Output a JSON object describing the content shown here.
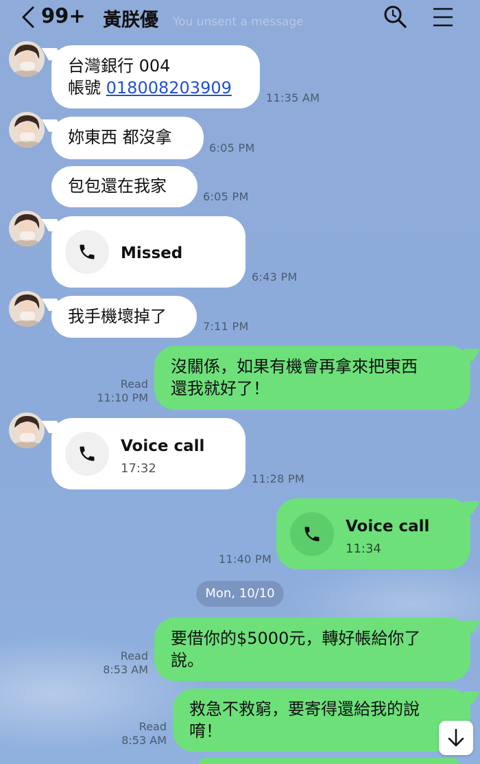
{
  "header": {
    "unread_count": "99+",
    "contact_name": "黃朕優",
    "ghost_notice": "You unsent a message"
  },
  "messages": [
    {
      "line1": "台灣銀行 004",
      "line2_label": "帳號 ",
      "account_number": "018008203909",
      "time": "11:35 AM"
    },
    {
      "text": "妳東西 都沒拿",
      "time": "6:05 PM"
    },
    {
      "text": "包包還在我家",
      "time": "6:05 PM"
    },
    {
      "call_title": "Missed",
      "time": "6:43 PM"
    },
    {
      "text": "我手機壞掉了",
      "time": "7:11 PM"
    },
    {
      "line1": "沒關係，如果有機會再拿來把東西",
      "line2": "還我就好了！",
      "read": "Read",
      "time": "11:10 PM"
    },
    {
      "call_title": "Voice call",
      "call_duration": "17:32",
      "time": "11:28 PM"
    },
    {
      "call_title": "Voice call",
      "call_duration": "11:34",
      "time": "11:40 PM"
    },
    {
      "line1": "要借你的$5000元，轉好帳給你了",
      "line2": "說。",
      "read": "Read",
      "time": "8:53 AM"
    },
    {
      "line1": "救急不救窮，要寄得還給我的說",
      "line2": "唷！",
      "read": "Read",
      "time": "8:53 AM"
    }
  ],
  "date_divider": "Mon, 10/10",
  "icons": {
    "back": "chevron-left-icon",
    "search": "search-icon",
    "menu": "hamburger-menu-icon",
    "phone": "phone-icon",
    "scroll_down": "arrow-down-icon"
  },
  "colors": {
    "background": "#8dabd8",
    "incoming_bubble": "#ffffff",
    "outgoing_bubble": "#6de07a",
    "link": "#1f4fd8"
  }
}
